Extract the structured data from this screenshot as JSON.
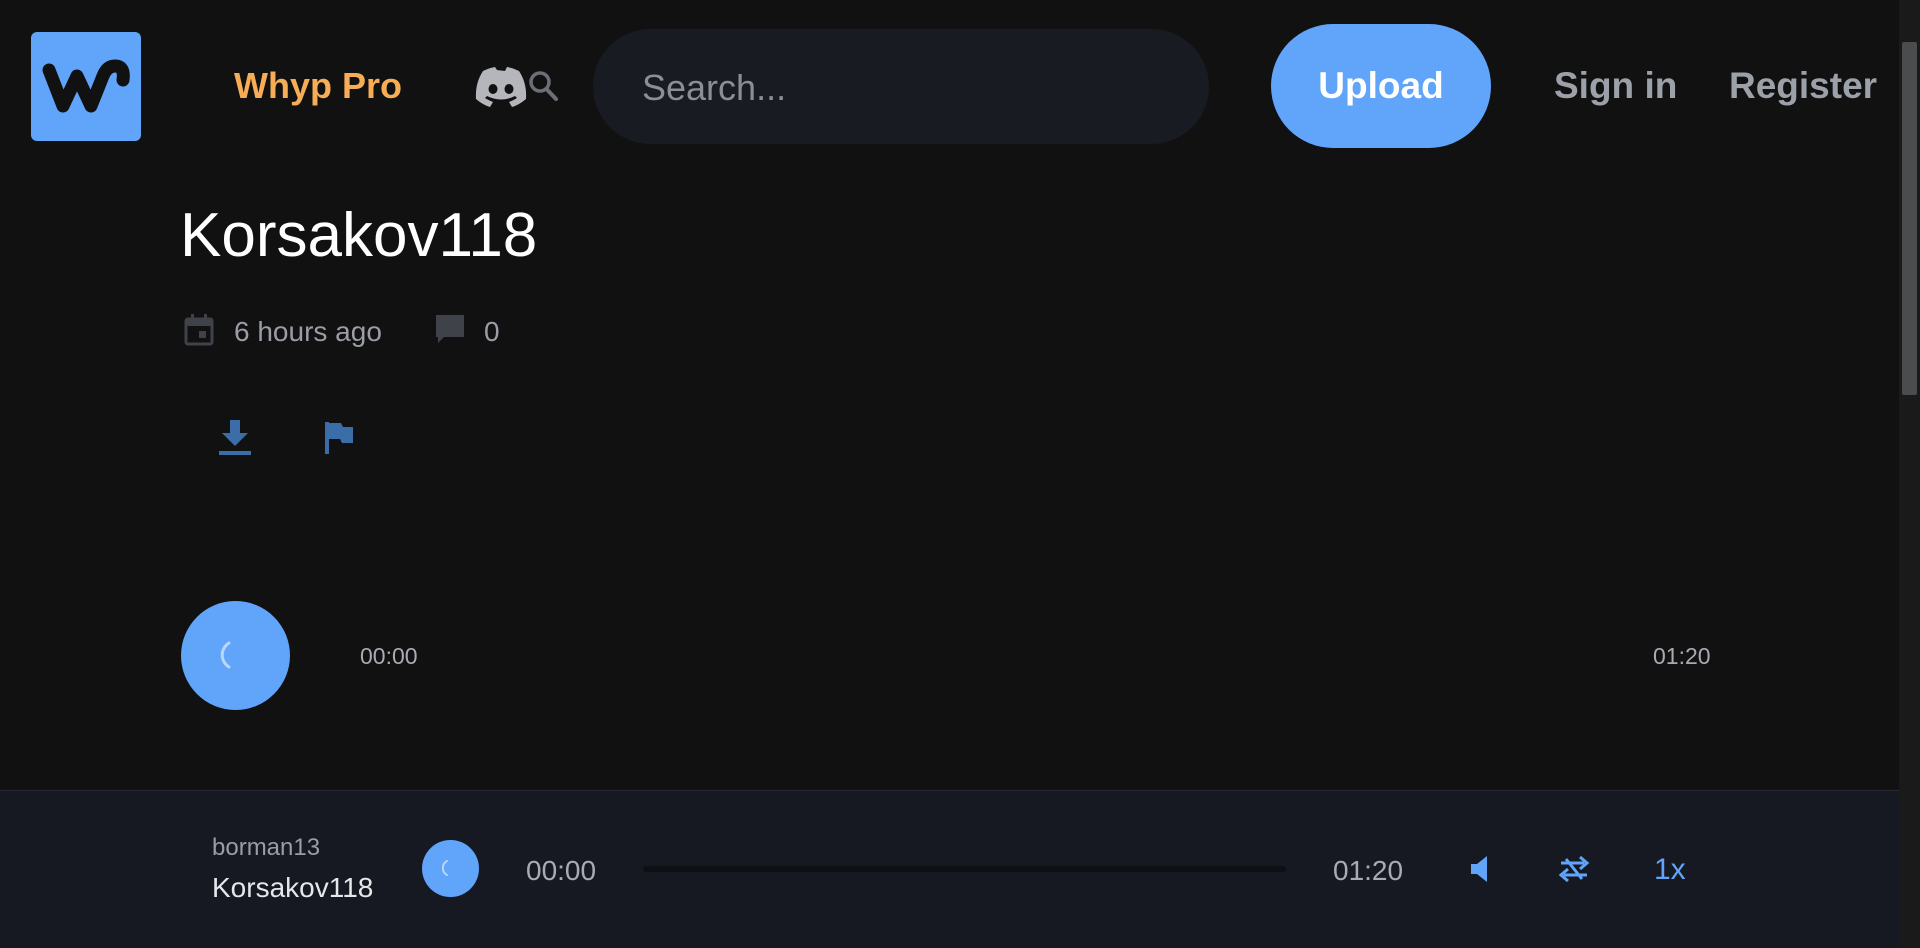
{
  "header": {
    "logo_icon": "whyp-logo",
    "pro_label": "Whyp Pro",
    "discord_icon": "discord-icon",
    "search": {
      "placeholder": "Search...",
      "value": ""
    },
    "upload_label": "Upload",
    "signin_label": "Sign in",
    "register_label": "Register"
  },
  "track": {
    "title": "Korsakov118",
    "posted": "6 hours ago",
    "comment_count": "0",
    "actions": [
      "download-icon",
      "flag-icon"
    ]
  },
  "player": {
    "current_time": "00:00",
    "duration": "01:20"
  },
  "bottom_bar": {
    "artist": "borman13",
    "track": "Korsakov118",
    "current_time": "00:00",
    "duration": "01:20",
    "progress_fraction": 0,
    "speed_label": "1x"
  },
  "colors": {
    "accent": "#60a5fa",
    "pro": "#f6ad55",
    "background": "#111112",
    "bar": "#171922"
  }
}
